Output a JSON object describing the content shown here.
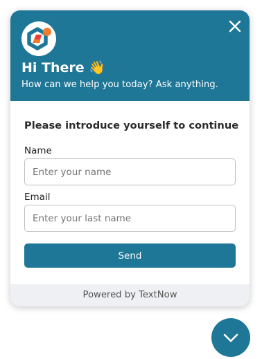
{
  "header": {
    "greeting": "Hi There",
    "greeting_emoji": "👋",
    "subtitle": "How can we help you today? Ask anything.",
    "logo_icon": "brand-logo-icon",
    "close_icon": "close-icon",
    "background_color": "#1f7797"
  },
  "form": {
    "title": "Please introduce yourself to continue",
    "name_label": "Name",
    "name_placeholder": "Enter your name",
    "name_value": "",
    "email_label": "Email",
    "email_placeholder": "Enter your last name",
    "email_value": "",
    "send_label": "Send"
  },
  "footer": {
    "text": "Powered by TextNow"
  },
  "launcher": {
    "icon": "chevron-down-icon",
    "color": "#1f7797"
  },
  "colors": {
    "accent": "#1f7797",
    "logo_orange": "#f47a2e",
    "logo_red": "#e8413a"
  }
}
